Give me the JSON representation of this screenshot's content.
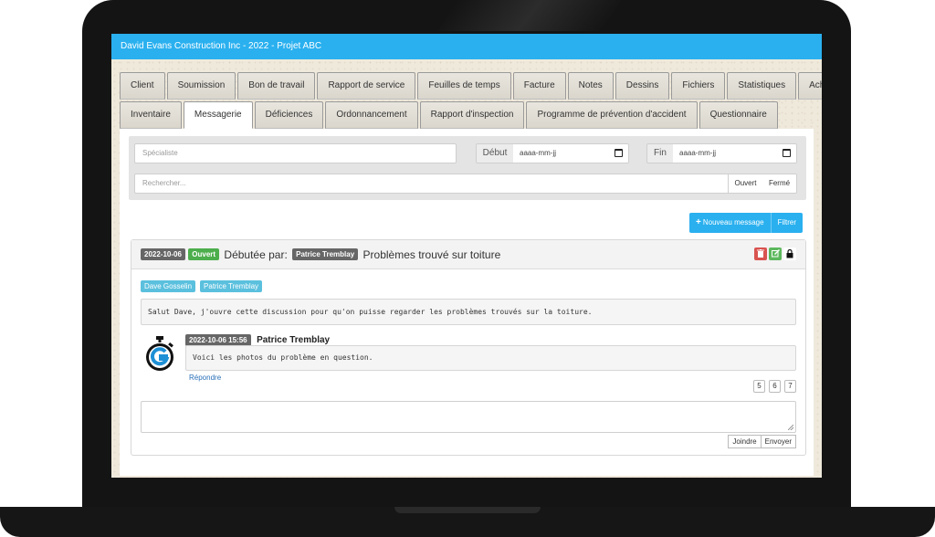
{
  "window": {
    "title": "David Evans Construction Inc - 2022 - Projet ABC"
  },
  "tabs": {
    "row1": [
      "Client",
      "Soumission",
      "Bon de travail",
      "Rapport de service",
      "Feuilles de temps",
      "Facture",
      "Notes",
      "Dessins",
      "Fichiers",
      "Statistiques",
      "Achats"
    ],
    "row2": [
      "Inventaire",
      "Messagerie",
      "Déficiences",
      "Ordonnancement",
      "Rapport d'inspection",
      "Programme de prévention d'accident",
      "Questionnaire"
    ],
    "active": "Messagerie"
  },
  "filters": {
    "specialist_placeholder": "Spécialiste",
    "start_label": "Début",
    "start_value": "aaaa-mm-jj",
    "end_label": "Fin",
    "end_value": "aaaa-mm-jj",
    "search_placeholder": "Rechercher...",
    "open_label": "Ouvert",
    "closed_label": "Fermé"
  },
  "toolbar": {
    "new_message_label": "Nouveau message",
    "filter_label": "Filtrer"
  },
  "conversation": {
    "date": "2022-10-06",
    "status": "Ouvert",
    "started_by_label": "Débutée par:",
    "started_by": "Patrice Tremblay",
    "subject": "Problèmes trouvé sur toiture",
    "participants": [
      "Dave Gosselin",
      "Patrice Tremblay"
    ],
    "first_message": "Salut Dave, j'ouvre cette discussion pour qu'on puisse regarder les problèmes trouvés sur la toiture.",
    "reply": {
      "timestamp": "2022-10-06 15:56",
      "author": "Patrice Tremblay",
      "text": "Voici les photos du problème en question.",
      "reply_label": "Répondre"
    },
    "attachments": [
      "5",
      "6",
      "7"
    ],
    "attach_label": "Joindre",
    "send_label": "Envoyer"
  },
  "colors": {
    "accent": "#2ab0ef",
    "open_status": "#4cae4c",
    "delete": "#d9534f",
    "edit": "#5cb85c"
  }
}
